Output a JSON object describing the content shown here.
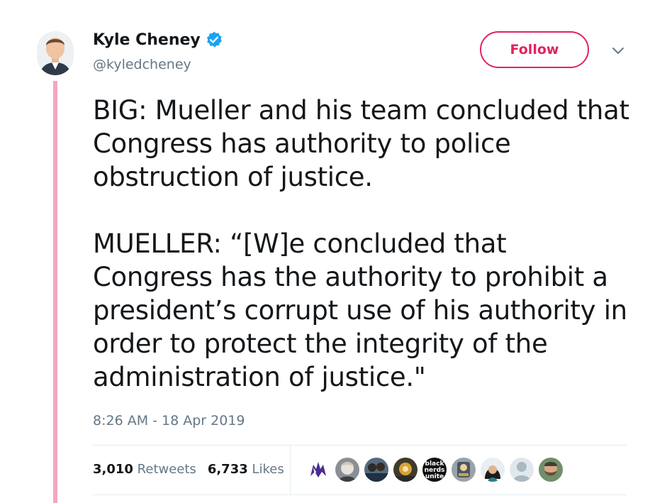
{
  "user": {
    "name": "Kyle Cheney",
    "handle": "@kyledcheney",
    "verified": true
  },
  "follow_label": "Follow",
  "tweet": {
    "text": "BIG: Mueller and his team concluded that\nCongress has authority to police\nobstruction of justice.\n\nMUELLER: “[W]e concluded that\nCongress has the authority to prohibit a\npresident’s corrupt use of his authority in\norder to protect the integrity of the\nadministration of justice.\"",
    "timestamp": "8:26 AM - 18 Apr 2019"
  },
  "stats": {
    "retweets_count": "3,010",
    "retweets_label": "Retweets",
    "likes_count": "6,733",
    "likes_label": "Likes"
  },
  "likers_badge_text": [
    "black",
    "nerds",
    "unite"
  ],
  "colors": {
    "accent": "#e0245e",
    "thread_line": "#f4a7bd",
    "verified": "#1da1f2",
    "muted": "#657786"
  }
}
